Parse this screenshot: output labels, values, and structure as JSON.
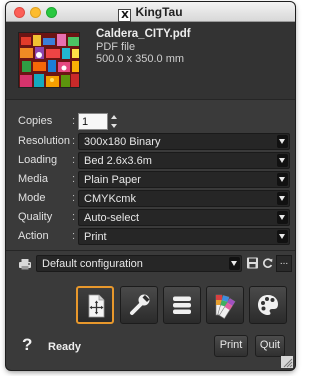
{
  "window": {
    "title": "KingTau",
    "logo_glyph": "X"
  },
  "file": {
    "name": "Caldera_CITY.pdf",
    "type": "PDF file",
    "size": "500.0 x 350.0 mm",
    "thumbnail_icon": "city-illustration-thumbnail"
  },
  "settings": {
    "copies": {
      "label": "Copies",
      "value": "1"
    },
    "resolution": {
      "label": "Resolution",
      "value": "300x180 Binary"
    },
    "loading": {
      "label": "Loading",
      "value": "Bed 2.6x3.6m"
    },
    "media": {
      "label": "Media",
      "value": "Plain Paper"
    },
    "mode": {
      "label": "Mode",
      "value": "CMYKcmk"
    },
    "quality": {
      "label": "Quality",
      "value": "Auto-select"
    },
    "action": {
      "label": "Action",
      "value": "Print"
    },
    "colon": ":"
  },
  "config": {
    "value": "Default configuration",
    "more_label": "..."
  },
  "tools": [
    {
      "icon": "layout-move-icon",
      "active": true
    },
    {
      "icon": "wrench-icon",
      "active": false
    },
    {
      "icon": "list-icon",
      "active": false
    },
    {
      "icon": "color-swatches-icon",
      "active": false
    },
    {
      "icon": "palette-icon",
      "active": false
    }
  ],
  "footer": {
    "help_glyph": "?",
    "status": "Ready",
    "print_label": "Print",
    "quit_label": "Quit"
  },
  "colors": {
    "accent": "#e8982c",
    "window_bg": "#3a3a3a"
  }
}
